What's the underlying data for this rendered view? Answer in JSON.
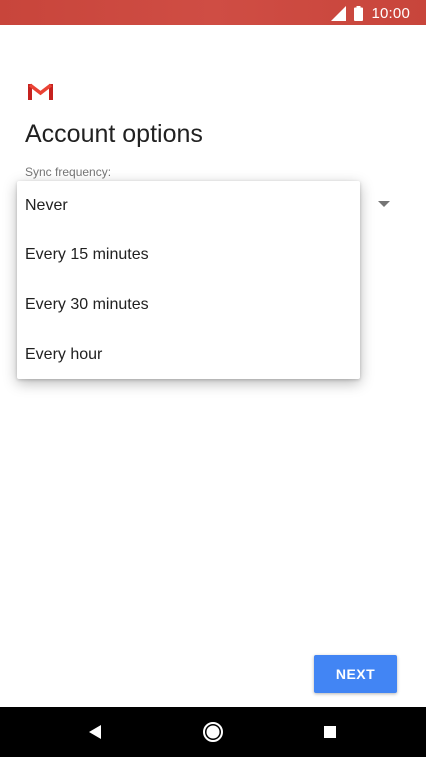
{
  "status_bar": {
    "time": "10:00",
    "icons": [
      "signal-icon",
      "battery-icon"
    ],
    "color": "#c8453b"
  },
  "app": {
    "logo": "gmail-logo",
    "title": "Account options"
  },
  "sync": {
    "label": "Sync frequency:",
    "options": [
      "Never",
      "Every 15 minutes",
      "Every 30 minutes",
      "Every hour"
    ]
  },
  "actions": {
    "next_label": "NEXT",
    "accent_color": "#4285f4"
  },
  "navigation_bar": {
    "buttons": [
      "back-icon",
      "home-icon",
      "recents-icon"
    ]
  }
}
